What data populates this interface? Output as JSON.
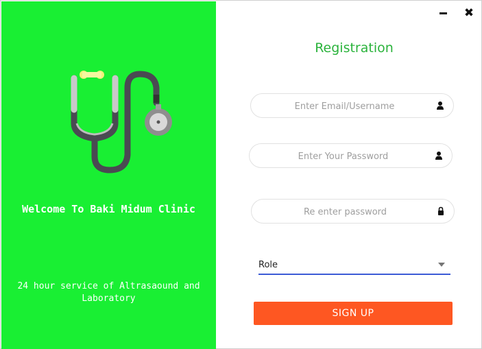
{
  "window": {
    "minimize_icon": "minimize-icon",
    "close_icon": "close-icon",
    "close_glyph": "✖"
  },
  "left": {
    "background": "#19ef33",
    "logo_icon": "stethoscope-icon",
    "welcome": "Welcome To Baki Midum Clinic",
    "tagline_line1": "24 hour service of Altrasaound and",
    "tagline_line2": "Laboratory"
  },
  "form": {
    "title": "Registration",
    "email_placeholder": "Enter Email/Username",
    "email_icon": "user-icon",
    "password_placeholder": "Enter Your Password",
    "password_icon": "user-icon",
    "repassword_placeholder": "Re enter password",
    "repassword_icon": "lock-icon",
    "role_label": "Role",
    "signup_label": "SIGN UP",
    "accent": "#2bb33c",
    "button_color": "#fe5722",
    "underline_color": "#3c5bd6"
  }
}
